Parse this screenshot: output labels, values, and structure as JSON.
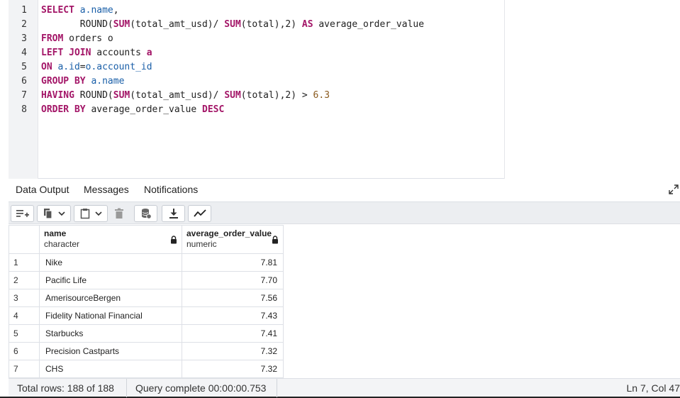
{
  "editor": {
    "line_numbers": [
      "1",
      "2",
      "3",
      "4",
      "5",
      "6",
      "7",
      "8"
    ]
  },
  "tabs": [
    "Data Output",
    "Messages",
    "Notifications"
  ],
  "toolbar": {
    "icons": [
      "add-row-icon",
      "copy-icon",
      "chevron-down-icon",
      "paste-icon",
      "chevron-down-icon",
      "delete-icon",
      "save-data-icon",
      "download-icon",
      "graph-icon"
    ]
  },
  "grid": {
    "columns": [
      {
        "name": "name",
        "type": "character"
      },
      {
        "name": "average_order_value",
        "type": "numeric"
      }
    ],
    "rows": [
      {
        "n": "1",
        "name": "Nike",
        "value": "7.81"
      },
      {
        "n": "2",
        "name": "Pacific Life",
        "value": "7.70"
      },
      {
        "n": "3",
        "name": "AmerisourceBergen",
        "value": "7.56"
      },
      {
        "n": "4",
        "name": "Fidelity National Financial",
        "value": "7.43"
      },
      {
        "n": "5",
        "name": "Starbucks",
        "value": "7.41"
      },
      {
        "n": "6",
        "name": "Precision Castparts",
        "value": "7.32"
      },
      {
        "n": "7",
        "name": "CHS",
        "value": "7.32"
      }
    ]
  },
  "status": {
    "total_rows": "Total rows: 188 of 188",
    "query_time": "Query complete 00:00:00.753",
    "cursor": "Ln 7, Col 47"
  }
}
